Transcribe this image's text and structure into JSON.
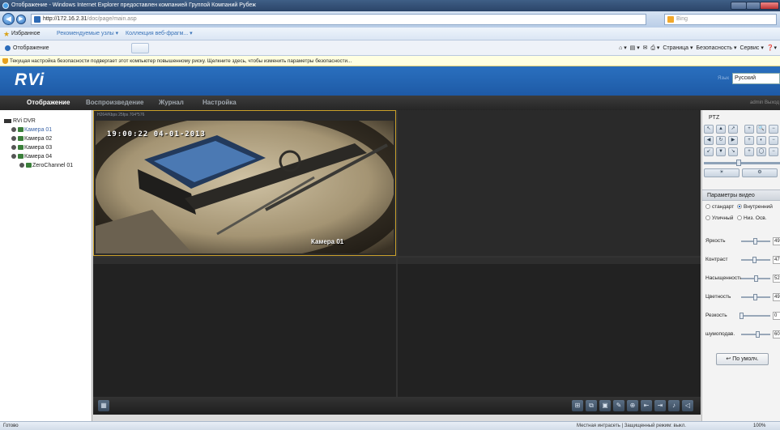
{
  "browser": {
    "title": "Отображение - Windows Internet Explorer предоставлен компанией Группой Компаний Рубеж",
    "url_host": "http://172.16.2.31",
    "url_path": "/doc/page/main.asp",
    "search_placeholder": "Bing",
    "favorites_label": "Избранное",
    "favorites_items": [
      "Рекомендуемые узлы ▾",
      "Коллекция веб-фрагм... ▾"
    ],
    "tab_title": "Отображение",
    "commands": [
      "Страница ▾",
      "Безопасность ▾",
      "Сервис ▾"
    ],
    "info_bar": "Текущая настройка безопасности подвергает этот компьютер повышенному риску. Щелкните здесь, чтобы изменить параметры безопасности...",
    "status_left": "Готово",
    "status_zone": "Местная интрасеть | Защищенный режим: выкл.",
    "zoom": "100%"
  },
  "app": {
    "logo": "RVi",
    "language_label": "Язык",
    "language": "Русский",
    "user_info": "admin  Выход",
    "menu": [
      {
        "label": "Отображение",
        "active": true
      },
      {
        "label": "Воспроизведение",
        "active": false
      },
      {
        "label": "Журнал",
        "active": false
      },
      {
        "label": "Настройка",
        "active": false
      }
    ]
  },
  "tree": {
    "root": "RVi DVR",
    "cameras": [
      "Камера 01",
      "Камера 02",
      "Камера 03",
      "Камера 04"
    ],
    "zero_channel": "ZeroChannel 01"
  },
  "video": {
    "stream_info": "H264/Kbps  25fps  704*576",
    "osd_datetime": "19:00:22  04-01-2013",
    "osd_camera": "Камера 01"
  },
  "ptz": {
    "title": "PTZ",
    "buttons": [
      "↖",
      "▲",
      "↗",
      "+",
      "🔍",
      "−",
      "◀",
      "↻",
      "▶",
      "+",
      "◐",
      "−",
      "↙",
      "▼",
      "↘",
      "+",
      "◯",
      "−"
    ],
    "bottom_buttons": [
      "☀",
      "⚙"
    ],
    "speed": 0.45
  },
  "video_params": {
    "title": "Параметры видео",
    "modes": [
      {
        "label": "стандарт",
        "checked": false
      },
      {
        "label": "Внутренний",
        "checked": true
      },
      {
        "label": "Уличный",
        "checked": false
      },
      {
        "label": "Низ. Осв.",
        "checked": false
      }
    ],
    "sliders": [
      {
        "label": "Яркость",
        "value": "49",
        "level": 0.49
      },
      {
        "label": "Контраст",
        "value": "47",
        "level": 0.47
      },
      {
        "label": "Насыщенность",
        "value": "52",
        "level": 0.52
      },
      {
        "label": "Цветность",
        "value": "49",
        "level": 0.49
      },
      {
        "label": "Резкость",
        "value": "0",
        "level": 0.0
      },
      {
        "label": "шумоподав.",
        "value": "60",
        "level": 0.6
      }
    ],
    "default_button": "↩ По умолч."
  },
  "toolbar": {
    "left_icon": "layout-icon",
    "right_icons": [
      "⊞",
      "⧉",
      "▣",
      "✎",
      "⊕",
      "⇤",
      "⇥",
      "♪",
      "◁"
    ]
  }
}
